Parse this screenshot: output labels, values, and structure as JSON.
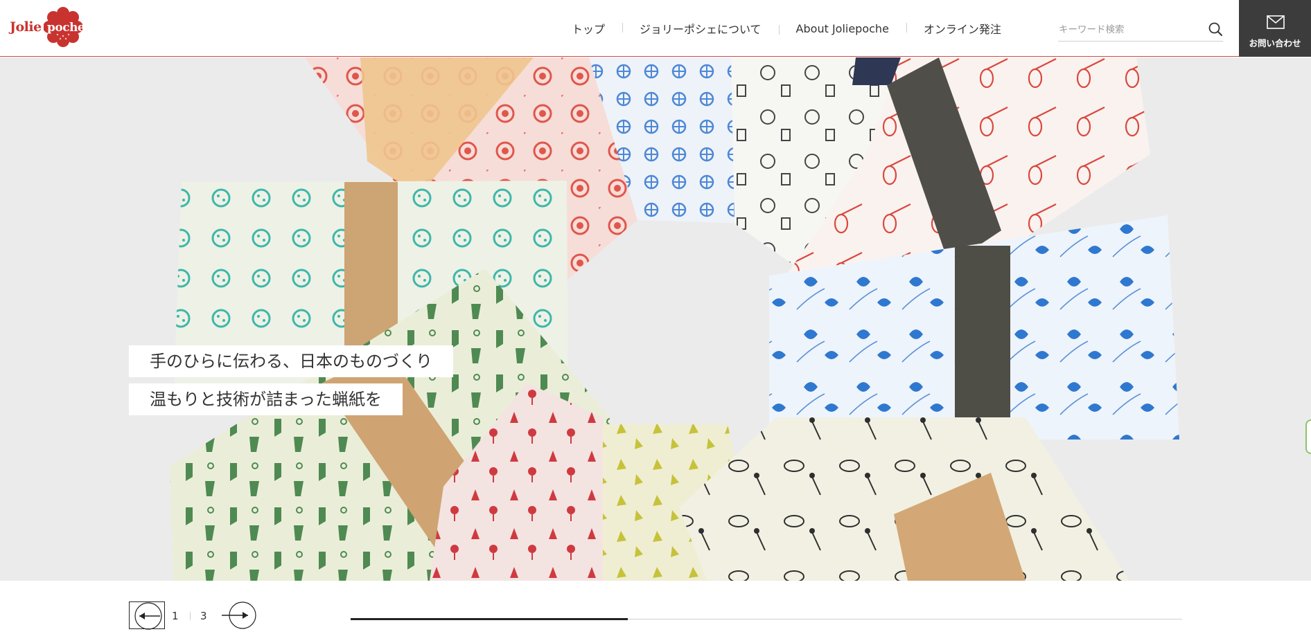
{
  "header": {
    "logo": {
      "word1": "Jolie",
      "word2": "poche"
    },
    "nav": [
      {
        "label": "トップ"
      },
      {
        "label": "ジョリーポシェについて"
      },
      {
        "label": "About Joliepoche"
      },
      {
        "label": "オンライン発注"
      }
    ],
    "search": {
      "placeholder": "キーワード検索",
      "value": "",
      "icon": "search-icon"
    },
    "contact": {
      "label": "お問い合わせ",
      "icon": "mail-icon"
    }
  },
  "hero": {
    "captions": [
      "手のひらに伝わる、日本のものづくり",
      "温もりと技術が詰まった蝋紙を"
    ],
    "image_subject": "wax paper bags in assorted printed patterns arranged in a circle"
  },
  "slider": {
    "current": "1",
    "total": "3",
    "progress": 0.333,
    "prev_icon": "arrow-left-icon",
    "next_icon": "arrow-right-icon"
  },
  "colors": {
    "brand_red": "#c9332f",
    "header_border": "#c94b42",
    "contact_bg": "#3c3c3c",
    "side_tab": "#8cc46b"
  }
}
